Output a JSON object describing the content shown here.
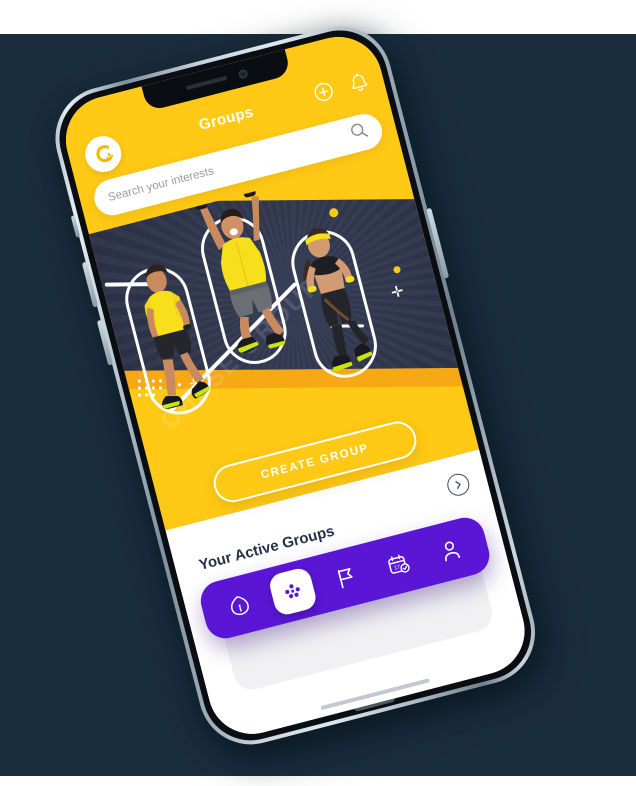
{
  "page": {
    "backdrop_color": "#1a2d3d",
    "band_color": "#ffffff"
  },
  "theme": {
    "yellow": "#FFC915",
    "orange": "#F6A815",
    "purple": "#5A16D4",
    "navy": "#22324a",
    "hero_dark": "#2B3147",
    "white": "#ffffff"
  },
  "app": {
    "header": {
      "title": "Groups",
      "logo_name": "brand-logo",
      "actions": [
        {
          "name": "add-icon",
          "label": "Add"
        },
        {
          "name": "bell-icon",
          "label": "Notifications"
        }
      ]
    },
    "search": {
      "placeholder": "Search your interests",
      "value": "",
      "icon": "search-icon"
    },
    "hero": {
      "watermark_text": "CHASE GROUP",
      "athletes": [
        {
          "name": "athlete-runner-left",
          "outfit": "yellow-shirt"
        },
        {
          "name": "athlete-jumper-center",
          "outfit": "yellow-shirt"
        },
        {
          "name": "athlete-sprinter-right",
          "outfit": "black-sportswear"
        }
      ]
    },
    "create_button": {
      "label": "CREATE GROUP"
    },
    "section": {
      "title": "Your Active Groups",
      "more_icon": "chevron-right-icon"
    },
    "bottom_nav": {
      "items": [
        {
          "name": "nav-home",
          "label": "Home",
          "icon": "home-icon",
          "active": false
        },
        {
          "name": "nav-groups",
          "label": "Groups",
          "icon": "groups-dots-icon",
          "active": true
        },
        {
          "name": "nav-flag",
          "label": "Challenges",
          "icon": "flag-icon",
          "active": false
        },
        {
          "name": "nav-calendar",
          "label": "Events",
          "icon": "calendar-check-icon",
          "active": false
        },
        {
          "name": "nav-profile",
          "label": "Profile",
          "icon": "person-icon",
          "active": false
        }
      ]
    }
  }
}
